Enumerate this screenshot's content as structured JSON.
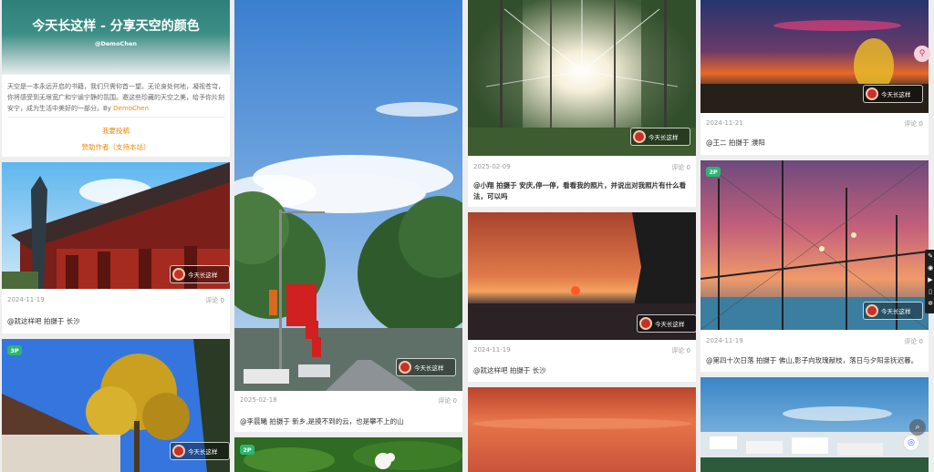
{
  "intro": {
    "title": "今天长这样 - 分享天空的颜色",
    "subtitle": "@DemoChen",
    "text_main": "天空是一本永远开启的书籍，我们只需仰首一望。无论身处何地，凝视苍穹，你将感受到无垠宽广和宁谧宁静的氛围。邀这些珍藏的天空之美，给予你片刻安宁，成为生活中美好的一部分。By ",
    "author": "DemoChen",
    "submit_label": "我要投稿",
    "sponsor_label": "赞助作者（支持本站）"
  },
  "watermark_text": "今天长这样",
  "posts": {
    "temple": {
      "date": "2024-11-19",
      "comments": "评论 0",
      "caption": "@就这样吧 拍摄于 长沙"
    },
    "tree": {
      "badge": "3P"
    },
    "street": {
      "date": "2025-02-18",
      "comments": "评论 0",
      "caption": "@李晨曦 拍摄于 新乡,是摸不到的云，也是攀不上的山"
    },
    "flower": {
      "badge": "2P"
    },
    "forest": {
      "date": "2025-02-09",
      "comments": "评论 0",
      "caption": "@小翔 拍摄于 安庆,停一停，看看我的照片，并说出对我照片有什么看法，可以吗"
    },
    "seaset": {
      "date": "2024-11-19",
      "comments": "评论 0",
      "caption": "@就这样吧 拍摄于 长沙"
    },
    "dusk": {
      "date": "2024-11-21",
      "comments": "评论 0",
      "caption": "@王二 拍摄于 濮阳"
    },
    "court": {
      "badge": "2P",
      "date": "2024-11-19",
      "comments": "评论 0",
      "caption": "@第四十次日落 拍摄于 佛山,影子向玫瑰献枝，落日与夕阳亲抚迟暮。"
    }
  },
  "colors": {
    "accent": "#f0890d",
    "badge": "#2bb673"
  },
  "icons": [
    "link-icon",
    "camera-icon",
    "video-icon",
    "bookmark-icon",
    "gear-icon",
    "search-icon",
    "logo-icon"
  ]
}
